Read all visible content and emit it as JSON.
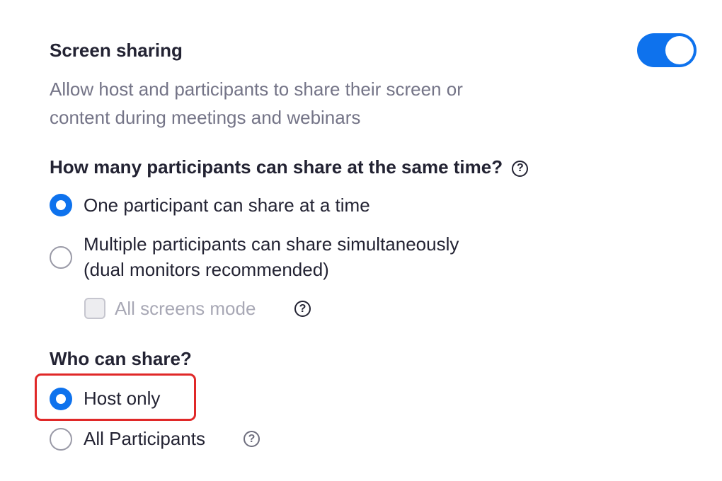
{
  "screen_sharing": {
    "title": "Screen sharing",
    "description_line1": "Allow host and participants to share their screen or",
    "description_line2": "content during meetings and webinars",
    "toggle_on": true
  },
  "share_count": {
    "question": "How many participants can share at the same time?",
    "help_glyph": "?",
    "options": [
      {
        "label": "One participant can share at a time",
        "selected": true
      },
      {
        "label_line1": "Multiple participants can share simultaneously",
        "label_line2": "(dual monitors recommended)",
        "selected": false
      }
    ],
    "all_screens_mode": {
      "label": "All screens mode",
      "checked": false,
      "disabled": true,
      "help_glyph": "?"
    }
  },
  "who_can_share": {
    "question": "Who can share?",
    "options": [
      {
        "label": "Host only",
        "selected": true
      },
      {
        "label": "All Participants",
        "selected": false,
        "help_glyph": "?"
      }
    ]
  },
  "colors": {
    "accent": "#0e72ed",
    "highlight": "#e02828",
    "muted_text": "#747487",
    "disabled_text": "#a8a8b5"
  }
}
